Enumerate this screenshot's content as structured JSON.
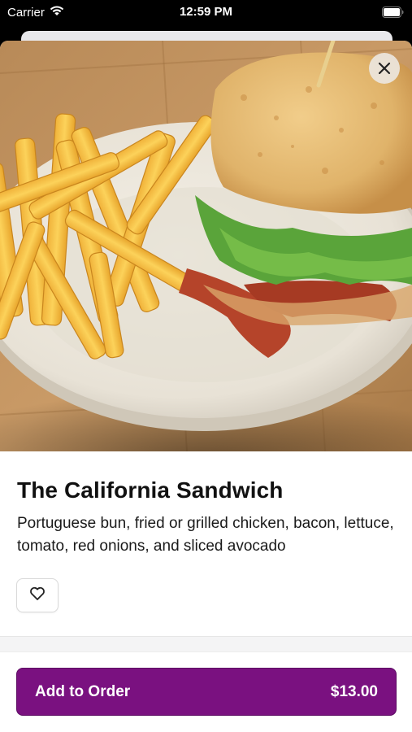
{
  "status_bar": {
    "carrier": "Carrier",
    "time": "12:59 PM"
  },
  "icons": {
    "close": "close-icon",
    "favorite": "heart-icon",
    "wifi": "wifi-icon",
    "battery": "battery-icon"
  },
  "item": {
    "title": "The California Sandwich",
    "description": "Portuguese bun, fried or grilled chicken, bacon, lettuce, tomato, red onions, and sliced avocado"
  },
  "footer": {
    "add_label": "Add to Order",
    "price": "$13.00"
  },
  "colors": {
    "accent": "#7a1180",
    "background": "#ffffff"
  }
}
